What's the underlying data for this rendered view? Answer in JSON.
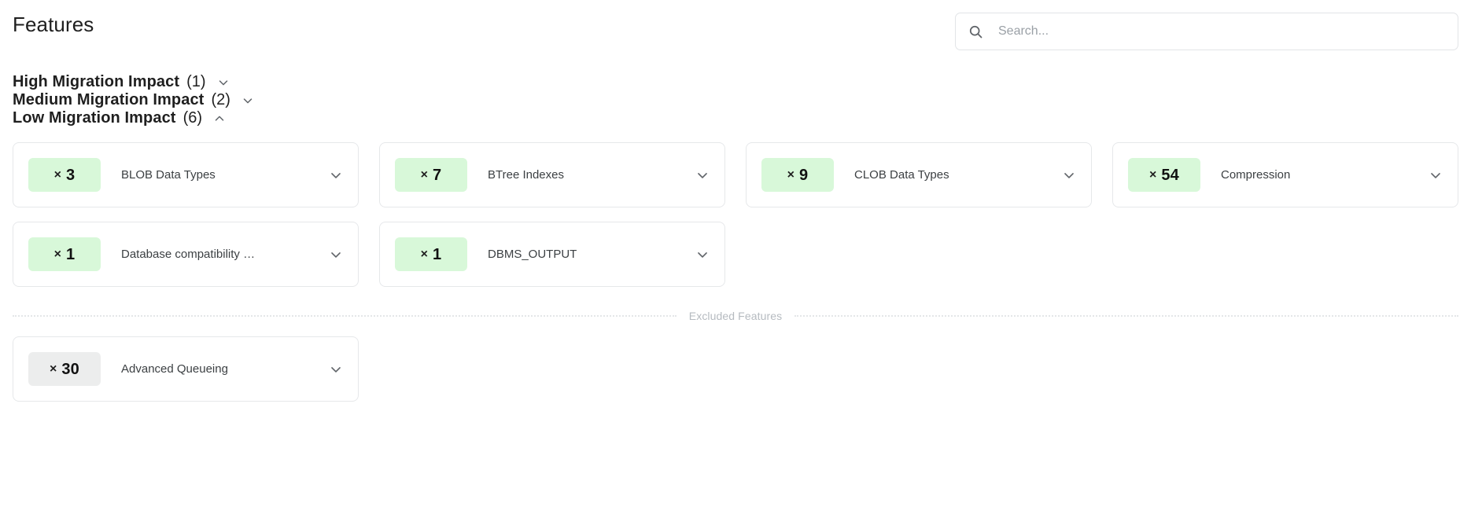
{
  "header": {
    "title": "Features",
    "search": {
      "placeholder": "Search...",
      "value": "",
      "icon": "search-icon"
    }
  },
  "groups": [
    {
      "id": "high",
      "title": "High Migration Impact",
      "count": "(1)",
      "expanded": false,
      "caret_icon": "chevron-down-icon"
    },
    {
      "id": "medium",
      "title": "Medium Migration Impact",
      "count": "(2)",
      "expanded": false,
      "caret_icon": "chevron-down-icon"
    },
    {
      "id": "low",
      "title": "Low Migration Impact",
      "count": "(6)",
      "expanded": true,
      "caret_icon": "chevron-up-icon"
    }
  ],
  "features": [
    {
      "multiplier": "×",
      "count": "3",
      "name": "BLOB Data Types",
      "excluded": false,
      "caret_icon": "chevron-down-icon"
    },
    {
      "multiplier": "×",
      "count": "7",
      "name": "BTree Indexes",
      "excluded": false,
      "caret_icon": "chevron-down-icon"
    },
    {
      "multiplier": "×",
      "count": "9",
      "name": "CLOB Data Types",
      "excluded": false,
      "caret_icon": "chevron-down-icon"
    },
    {
      "multiplier": "×",
      "count": "54",
      "name": "Compression",
      "excluded": false,
      "caret_icon": "chevron-down-icon"
    },
    {
      "multiplier": "×",
      "count": "1",
      "name": "Database compatibility …",
      "excluded": false,
      "caret_icon": "chevron-down-icon"
    },
    {
      "multiplier": "×",
      "count": "1",
      "name": "DBMS_OUTPUT",
      "excluded": false,
      "caret_icon": "chevron-down-icon"
    }
  ],
  "excluded_section": {
    "label": "Excluded Features",
    "features": [
      {
        "multiplier": "×",
        "count": "30",
        "name": "Advanced Queueing",
        "excluded": true,
        "caret_icon": "chevron-down-icon"
      }
    ]
  },
  "colors": {
    "badge_included_bg": "#d8f8d9",
    "badge_excluded_bg": "#eceded",
    "card_border": "#e6e8ea",
    "text_primary": "#1f1f1f",
    "text_secondary": "#3c4043",
    "muted": "#b6bbc0"
  }
}
